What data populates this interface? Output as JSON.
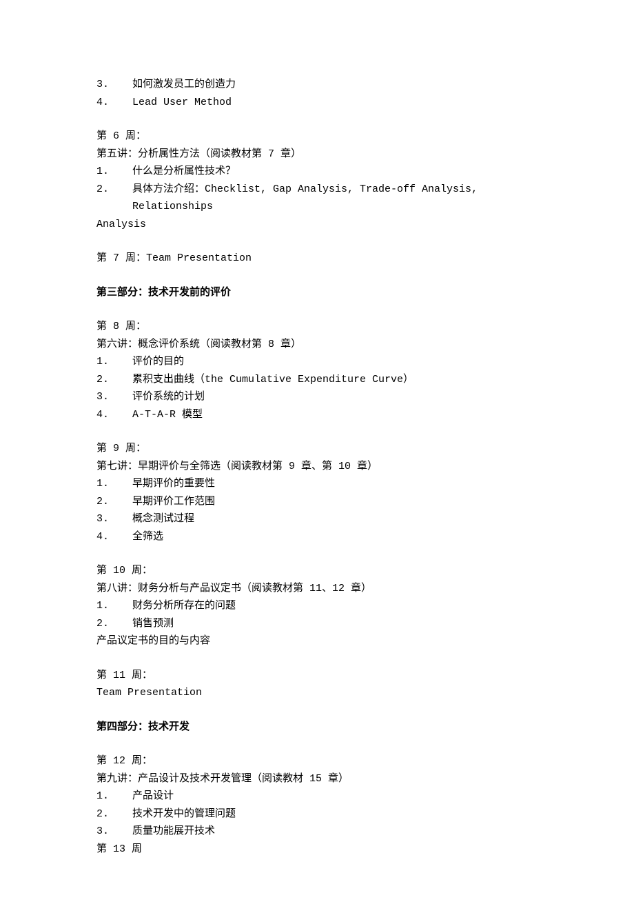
{
  "intro_items": [
    {
      "num": "3.",
      "text": "如何激发员工的创造力"
    },
    {
      "num": "4.",
      "text": "Lead User Method"
    }
  ],
  "week6": {
    "heading": "第 6 周：",
    "lecture": "第五讲：分析属性方法（阅读教材第 7 章）",
    "items": [
      {
        "num": "1.",
        "text": "什么是分析属性技术？"
      },
      {
        "num": "2.",
        "text": "具体方法介绍：Checklist, Gap Analysis, Trade-off Analysis, Relationships"
      }
    ],
    "analysis_line": "Analysis"
  },
  "week7": "第 7 周：Team Presentation",
  "section3_title": "第三部分：技术开发前的评价",
  "week8": {
    "heading": "第 8 周：",
    "lecture": "第六讲：概念评价系统（阅读教材第 8 章）",
    "items": [
      {
        "num": "1.",
        "text": "评价的目的"
      },
      {
        "num": "2.",
        "text": "累积支出曲线（the Cumulative Expenditure Curve）"
      },
      {
        "num": "3.",
        "text": "评价系统的计划"
      },
      {
        "num": "4.",
        "text": "A-T-A-R 模型"
      }
    ]
  },
  "week9": {
    "heading": "第 9 周：",
    "lecture": "第七讲：早期评价与全筛选（阅读教材第 9 章、第 10 章）",
    "items": [
      {
        "num": "1.",
        "text": "早期评价的重要性"
      },
      {
        "num": "2.",
        "text": "早期评价工作范围"
      },
      {
        "num": "3.",
        "text": "概念测试过程"
      },
      {
        "num": "4.",
        "text": "全筛选"
      }
    ]
  },
  "week10": {
    "heading": "第 10 周：",
    "lecture": "第八讲：财务分析与产品议定书（阅读教材第 11、12 章）",
    "items": [
      {
        "num": "1.",
        "text": "财务分析所存在的问题"
      },
      {
        "num": "2.",
        "text": "销售预测"
      }
    ],
    "tail": "产品议定书的目的与内容"
  },
  "week11": {
    "heading": "第 11 周：",
    "body": "Team Presentation"
  },
  "section4_title": "第四部分：技术开发",
  "week12": {
    "heading": "第 12 周：",
    "lecture": "第九讲：产品设计及技术开发管理（阅读教材 15 章）",
    "items": [
      {
        "num": "1.",
        "text": "产品设计"
      },
      {
        "num": "2.",
        "text": "技术开发中的管理问题"
      },
      {
        "num": "3.",
        "text": "质量功能展开技术"
      }
    ]
  },
  "week13": "第 13 周"
}
